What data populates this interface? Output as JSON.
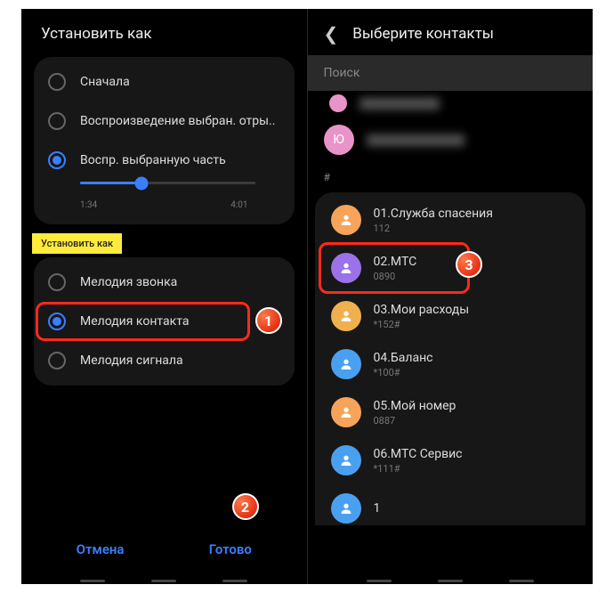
{
  "left": {
    "title": "Установить как",
    "play_options": [
      {
        "label": "Сначала",
        "selected": false
      },
      {
        "label": "Воспроизведение выбран. отры..",
        "selected": false
      },
      {
        "label": "Воспр. выбранную часть",
        "selected": true
      }
    ],
    "slider": {
      "start": "1:34",
      "end": "4:01",
      "pct": 35
    },
    "tag": "Установить как",
    "set_as": [
      {
        "label": "Мелодия звонка",
        "selected": false
      },
      {
        "label": "Мелодия контакта",
        "selected": true
      },
      {
        "label": "Мелодия сигнала",
        "selected": false
      }
    ],
    "cancel": "Отмена",
    "done": "Готово"
  },
  "right": {
    "title": "Выберите контакты",
    "search_placeholder": "Поиск",
    "top_contacts": [
      {
        "initial": "",
        "color": "av-pink",
        "blurred": true
      },
      {
        "initial": "Ю",
        "color": "av-pink",
        "blurred": true
      }
    ],
    "section": "#",
    "contacts": [
      {
        "name": "01.Служба спасения",
        "sub": "112",
        "color": "av-orange"
      },
      {
        "name": "02.МТС",
        "sub": "0890",
        "color": "av-purple",
        "highlight": true
      },
      {
        "name": "03.Мои расходы",
        "sub": "*152#",
        "color": "av-yellow"
      },
      {
        "name": "04.Баланс",
        "sub": "*100#",
        "color": "av-blue"
      },
      {
        "name": "05.Мой номер",
        "sub": "0887",
        "color": "av-orange"
      },
      {
        "name": "06.МТС Сервис",
        "sub": "*111#",
        "color": "av-blue"
      },
      {
        "name": "1",
        "sub": "",
        "color": "av-blue"
      }
    ]
  },
  "badges": {
    "b1": "1",
    "b2": "2",
    "b3": "3"
  }
}
